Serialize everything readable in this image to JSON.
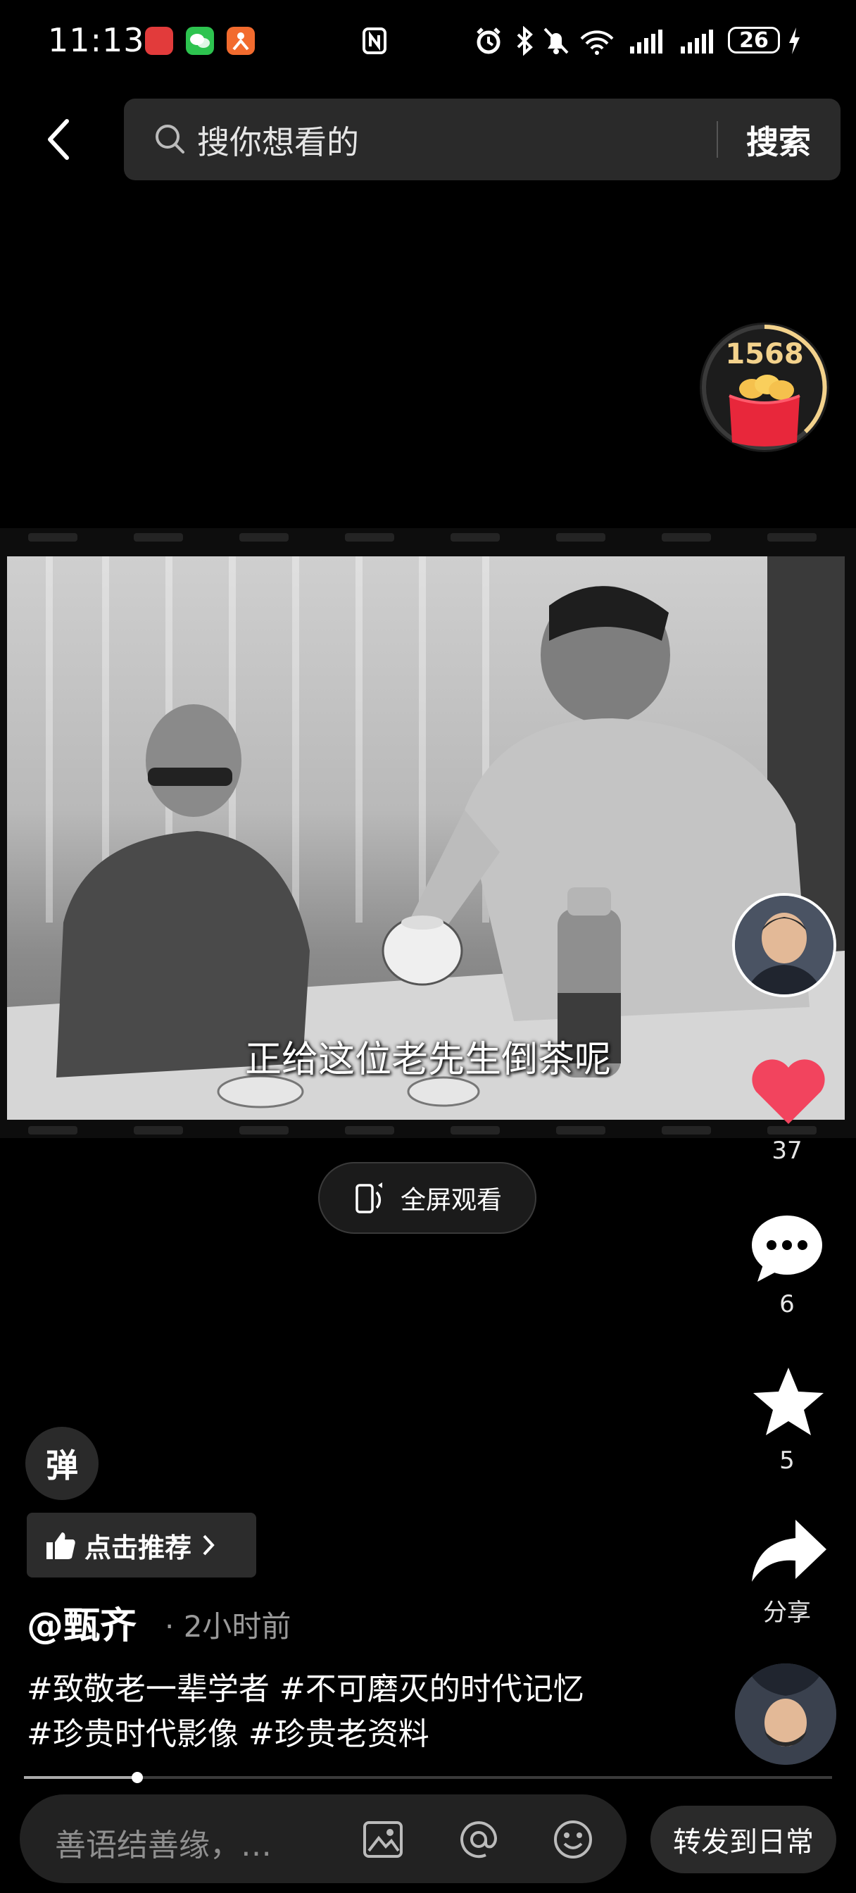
{
  "status_bar": {
    "time": "11:13",
    "battery": "26"
  },
  "search": {
    "placeholder": "搜你想看的",
    "button_label": "搜索"
  },
  "coins": {
    "count": "1568"
  },
  "video": {
    "subtitle": "正给这位老先生倒茶呢",
    "fullscreen_label": "全屏观看"
  },
  "actions": {
    "likes": "37",
    "comments": "6",
    "favorites": "5",
    "share_label": "分享"
  },
  "post": {
    "danmu_label": "弹",
    "recommend_label": "点击推荐",
    "username": "@甄齐",
    "time": "· 2小时前",
    "tags_line1": "#致敬老一辈学者 #不可磨灭的时代记忆",
    "tags_line2": "#珍贵时代影像 #珍贵老资料",
    "progress": 0.14
  },
  "comment_bar": {
    "placeholder": "善语结善缘，…",
    "share_daily_label": "转发到日常"
  },
  "colors": {
    "like": "#f2445e",
    "coin_text": "#f3d28c"
  },
  "icons": [
    "back-arrow-icon",
    "search-icon",
    "image-icon",
    "at-icon",
    "emoji-icon",
    "like-heart-icon",
    "comment-icon",
    "star-icon",
    "share-arrow-icon",
    "thumb-up-icon",
    "chevron-right-icon",
    "fullscreen-phone-icon",
    "red-envelope-icon"
  ]
}
